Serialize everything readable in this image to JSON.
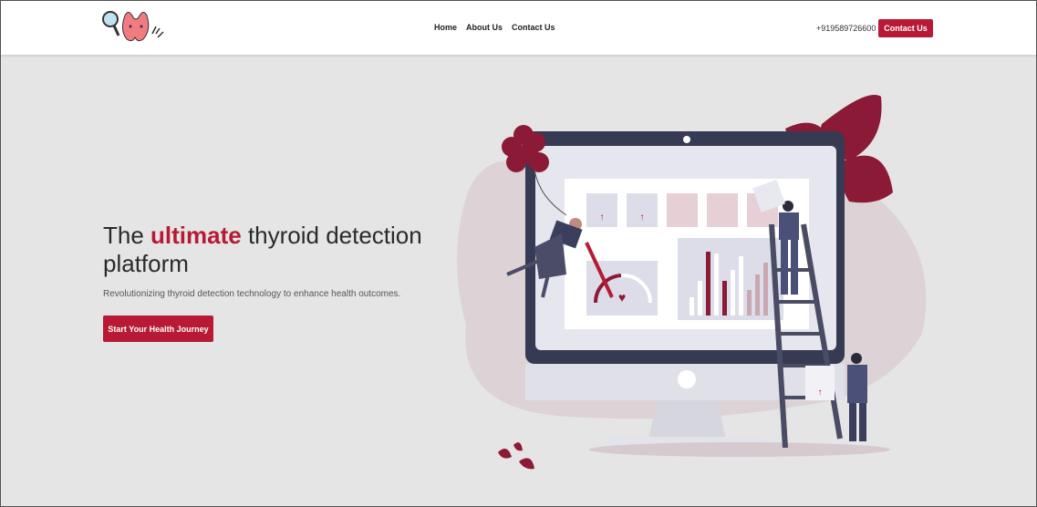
{
  "nav": {
    "links": [
      "Home",
      "About Us",
      "Contact Us"
    ],
    "phone": "+919589726600",
    "contact_button": "Contact Us"
  },
  "hero": {
    "title_pre": "The ",
    "title_accent": "ultimate",
    "title_post": " thyroid detection platform",
    "subtitle": "Revolutionizing thyroid detection technology to enhance health outcomes.",
    "cta": "Start Your Health Journey"
  },
  "colors": {
    "accent": "#b81a35",
    "dark": "#3b3b4f",
    "background": "#e5e5e5"
  },
  "icons": [
    "magnifier-icon",
    "thyroid-mascot-icon",
    "wave-hand-icon"
  ]
}
